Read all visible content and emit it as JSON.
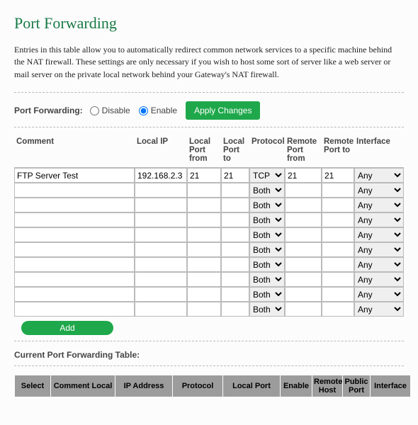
{
  "title": "Port Forwarding",
  "description": "Entries in this table allow you to automatically redirect common network services to a specific machine behind the NAT firewall. These settings are only necessary if you wish to host some sort of server like a web server or mail server on the private local network behind your Gateway's NAT firewall.",
  "pf_toggle": {
    "label": "Port Forwarding:",
    "disable": "Disable",
    "enable": "Enable",
    "selected": "Enable"
  },
  "apply_button": "Apply Changes",
  "headers": {
    "comment": "Comment",
    "local_ip": "Local IP",
    "local_port_from": "Local Port from",
    "local_port_to": "Local Port to",
    "protocol": "Protocol",
    "remote_port_from": "Remote Port from",
    "remote_port_to": "Remote Port to",
    "interface": "Interface"
  },
  "rows": [
    {
      "comment": "FTP Server Test",
      "local_ip": "192.168.2.3",
      "lpf": "21",
      "lpt": "21",
      "protocol": "TCP",
      "rpf": "21",
      "rpt": "21",
      "iface": "Any"
    },
    {
      "comment": "",
      "local_ip": "",
      "lpf": "",
      "lpt": "",
      "protocol": "Both",
      "rpf": "",
      "rpt": "",
      "iface": "Any"
    },
    {
      "comment": "",
      "local_ip": "",
      "lpf": "",
      "lpt": "",
      "protocol": "Both",
      "rpf": "",
      "rpt": "",
      "iface": "Any"
    },
    {
      "comment": "",
      "local_ip": "",
      "lpf": "",
      "lpt": "",
      "protocol": "Both",
      "rpf": "",
      "rpt": "",
      "iface": "Any"
    },
    {
      "comment": "",
      "local_ip": "",
      "lpf": "",
      "lpt": "",
      "protocol": "Both",
      "rpf": "",
      "rpt": "",
      "iface": "Any"
    },
    {
      "comment": "",
      "local_ip": "",
      "lpf": "",
      "lpt": "",
      "protocol": "Both",
      "rpf": "",
      "rpt": "",
      "iface": "Any"
    },
    {
      "comment": "",
      "local_ip": "",
      "lpf": "",
      "lpt": "",
      "protocol": "Both",
      "rpf": "",
      "rpt": "",
      "iface": "Any"
    },
    {
      "comment": "",
      "local_ip": "",
      "lpf": "",
      "lpt": "",
      "protocol": "Both",
      "rpf": "",
      "rpt": "",
      "iface": "Any"
    },
    {
      "comment": "",
      "local_ip": "",
      "lpf": "",
      "lpt": "",
      "protocol": "Both",
      "rpf": "",
      "rpt": "",
      "iface": "Any"
    },
    {
      "comment": "",
      "local_ip": "",
      "lpf": "",
      "lpt": "",
      "protocol": "Both",
      "rpf": "",
      "rpt": "",
      "iface": "Any"
    }
  ],
  "add_button": "Add",
  "current_table_title": "Current Port Forwarding Table:",
  "sub_headers": {
    "select": "Select",
    "comment_local": "Comment Local",
    "ip_address": "IP Address",
    "protocol": "Protocol",
    "local_port": "Local Port",
    "enable": "Enable",
    "remote_host": "Remote Host",
    "public_port": "Public Port",
    "interface": "Interface"
  }
}
